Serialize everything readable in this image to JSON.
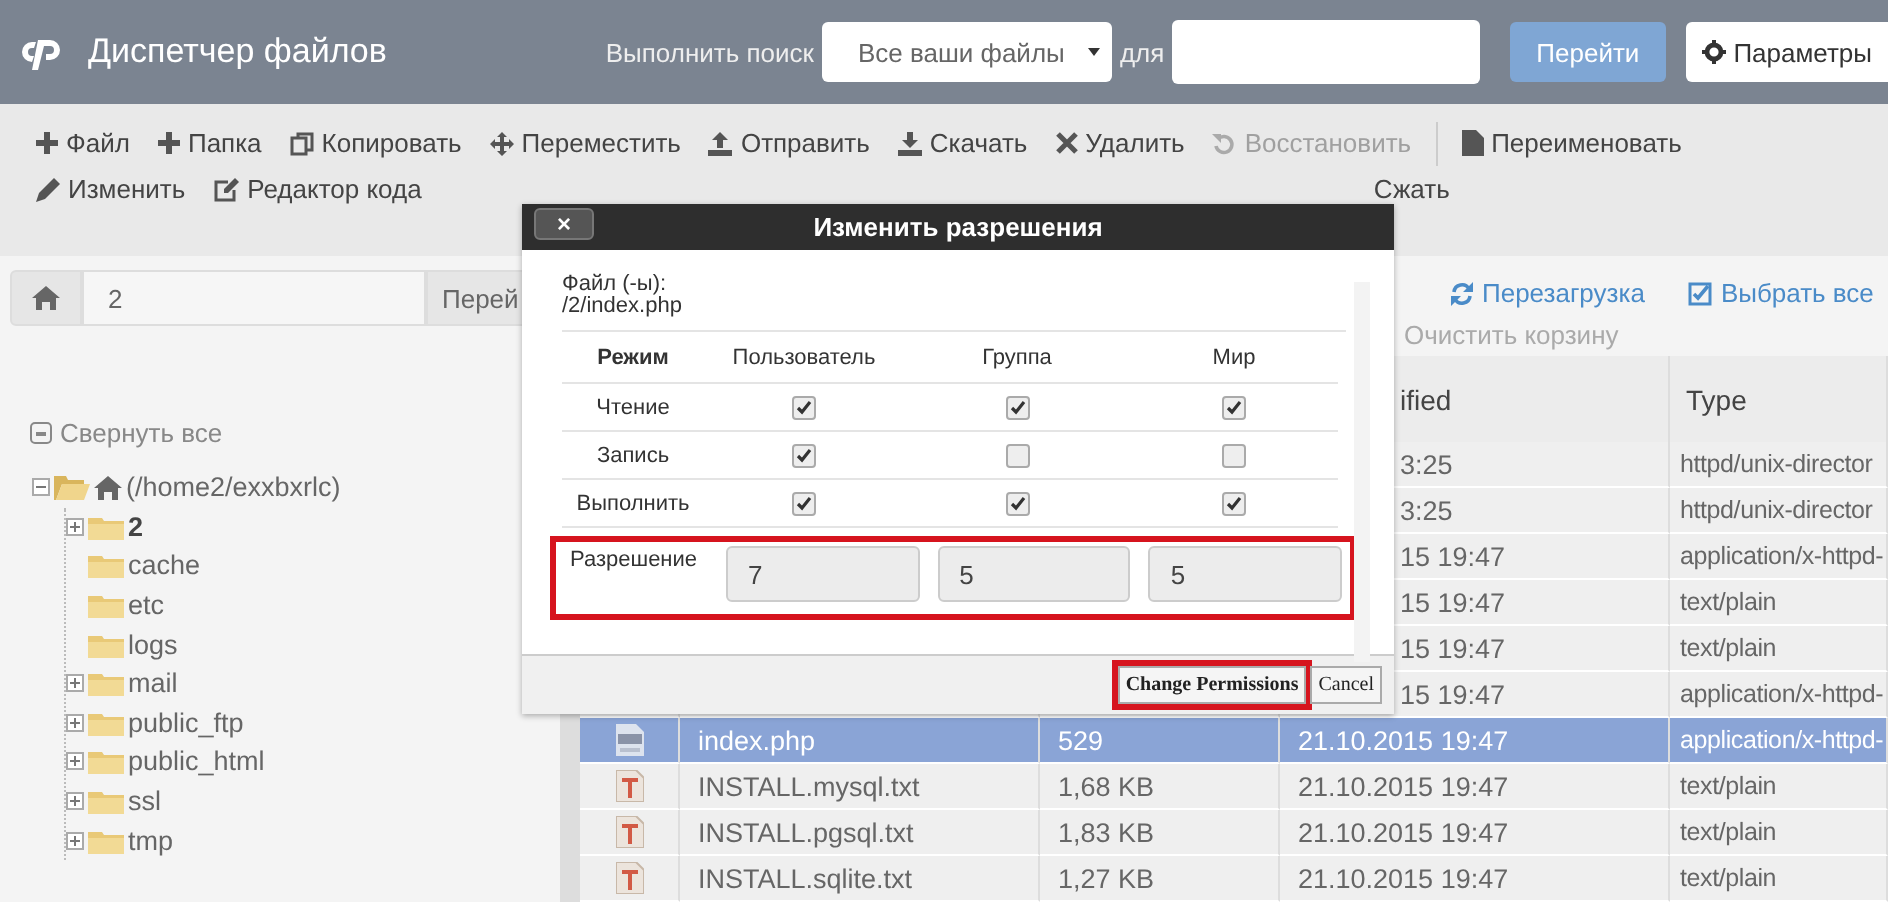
{
  "header": {
    "app_title": "Диспетчер файлов",
    "search_label": "Выполнить поиск",
    "search_scope": "Все ваши файлы",
    "for_label": "для",
    "go_button": "Перейти",
    "settings_button": "Параметры"
  },
  "toolbar": {
    "primary": [
      {
        "label": "Файл",
        "disabled": false
      },
      {
        "label": "Папка",
        "disabled": false
      },
      {
        "label": "Копировать",
        "disabled": false
      },
      {
        "label": "Переместить",
        "disabled": false
      },
      {
        "label": "Отправить",
        "disabled": false
      },
      {
        "label": "Скачать",
        "disabled": false
      },
      {
        "label": "Удалить",
        "disabled": false
      },
      {
        "label": "Восстановить",
        "disabled": true
      },
      {
        "label": "Переименовать",
        "disabled": false
      }
    ],
    "secondary": [
      {
        "label": "Изменить",
        "disabled": false
      },
      {
        "label": "Редактор кода",
        "disabled": false
      },
      {
        "label": "Сжать",
        "disabled": false
      }
    ]
  },
  "path_bar": {
    "value": "2",
    "go_button": "Перей"
  },
  "actions": [
    {
      "label": "Перезагрузка",
      "disabled": false
    },
    {
      "label": "Выбрать все",
      "disabled": false
    },
    {
      "label": "Очистить корзину",
      "disabled": true
    }
  ],
  "tree": {
    "collapse_all": "Свернуть все",
    "root": {
      "label": "(/home2/exxbxrlc)",
      "expanded": true,
      "children": [
        {
          "label": "2",
          "selected": true,
          "expandable": true
        },
        {
          "label": "cache",
          "selected": false,
          "expandable": false
        },
        {
          "label": "etc",
          "selected": false,
          "expandable": false
        },
        {
          "label": "logs",
          "selected": false,
          "expandable": false
        },
        {
          "label": "mail",
          "selected": false,
          "expandable": true
        },
        {
          "label": "public_ftp",
          "selected": false,
          "expandable": true
        },
        {
          "label": "public_html",
          "selected": false,
          "expandable": true
        },
        {
          "label": "ssl",
          "selected": false,
          "expandable": true
        },
        {
          "label": "tmp",
          "selected": false,
          "expandable": true
        }
      ]
    }
  },
  "table": {
    "columns": [
      "ified",
      "Type"
    ],
    "rows": [
      {
        "kind": "covered",
        "modified": "3:25",
        "type": "httpd/unix-director"
      },
      {
        "kind": "covered",
        "modified": "3:25",
        "type": "httpd/unix-director"
      },
      {
        "kind": "covered",
        "modified": "15 19:47",
        "type": "application/x-httpd-"
      },
      {
        "kind": "covered",
        "modified": "15 19:47",
        "type": "text/plain"
      },
      {
        "kind": "covered",
        "modified": "15 19:47",
        "type": "text/plain"
      },
      {
        "kind": "covered",
        "modified": "15 19:47",
        "type": "application/x-httpd-"
      },
      {
        "kind": "php",
        "name": "index.php",
        "size": "529",
        "modified": "21.10.2015 19:47",
        "type": "application/x-httpd-",
        "selected": true
      },
      {
        "kind": "text",
        "name": "INSTALL.mysql.txt",
        "size": "1,68 KB",
        "modified": "21.10.2015 19:47",
        "type": "text/plain",
        "selected": false
      },
      {
        "kind": "text",
        "name": "INSTALL.pgsql.txt",
        "size": "1,83 KB",
        "modified": "21.10.2015 19:47",
        "type": "text/plain",
        "selected": false
      },
      {
        "kind": "text",
        "name": "INSTALL.sqlite.txt",
        "size": "1,27 KB",
        "modified": "21.10.2015 19:47",
        "type": "text/plain",
        "selected": false
      }
    ]
  },
  "dialog": {
    "title": "Изменить разрешения",
    "close": "×",
    "file_label": "Файл (-ы):",
    "file_path": "/2/index.php",
    "columns": [
      "Режим",
      "Пользователь",
      "Группа",
      "Мир"
    ],
    "modes": [
      {
        "label": "Чтение",
        "user": true,
        "group": true,
        "world": true
      },
      {
        "label": "Запись",
        "user": true,
        "group": false,
        "world": false
      },
      {
        "label": "Выполнить",
        "user": true,
        "group": true,
        "world": true
      }
    ],
    "permission_label": "Разрешение",
    "permission_values": [
      "7",
      "5",
      "5"
    ],
    "buttons": [
      {
        "label": "Change Permissions",
        "highlighted": true
      },
      {
        "label": "Cancel",
        "highlighted": false
      }
    ]
  }
}
